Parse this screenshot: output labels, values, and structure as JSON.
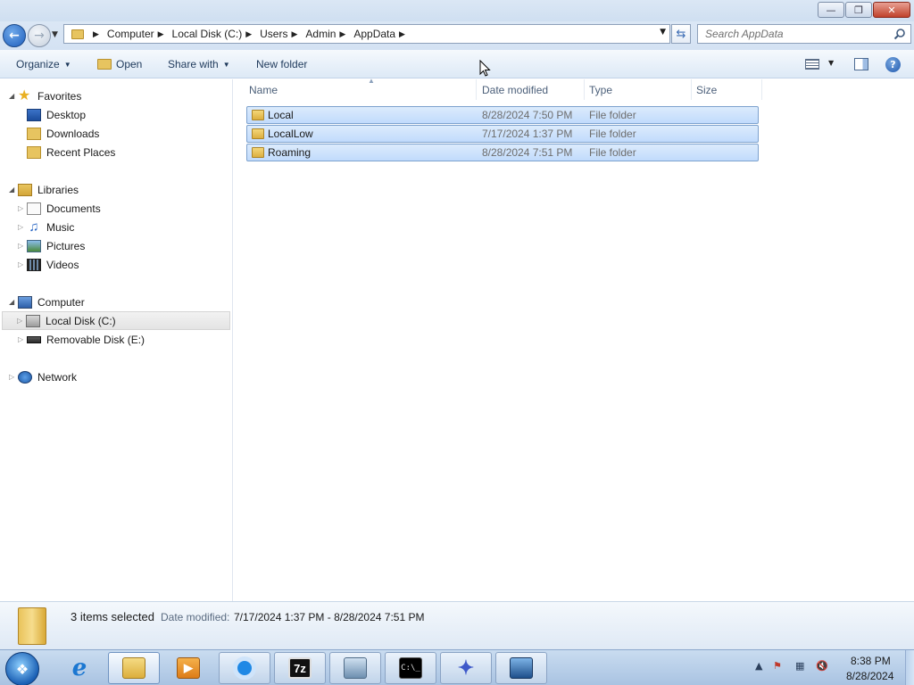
{
  "window": {
    "buttons": [
      "minimize",
      "maximize",
      "close"
    ]
  },
  "address": {
    "breadcrumb": [
      "Computer",
      "Local Disk (C:)",
      "Users",
      "Admin",
      "AppData"
    ],
    "search_placeholder": "Search AppData"
  },
  "toolbar": {
    "organize": "Organize",
    "open": "Open",
    "share_with": "Share with",
    "new_folder": "New folder"
  },
  "nav": {
    "favorites": "Favorites",
    "desktop": "Desktop",
    "downloads": "Downloads",
    "recent_places": "Recent Places",
    "libraries": "Libraries",
    "documents": "Documents",
    "music": "Music",
    "pictures": "Pictures",
    "videos": "Videos",
    "computer": "Computer",
    "local_disk": "Local Disk (C:)",
    "removable_disk": "Removable Disk (E:)",
    "network": "Network"
  },
  "columns": {
    "name": "Name",
    "date_modified": "Date modified",
    "type": "Type",
    "size": "Size"
  },
  "files": [
    {
      "name": "Local",
      "date": "8/28/2024 7:50 PM",
      "type": "File folder"
    },
    {
      "name": "LocalLow",
      "date": "7/17/2024 1:37 PM",
      "type": "File folder"
    },
    {
      "name": "Roaming",
      "date": "8/28/2024 7:51 PM",
      "type": "File folder"
    }
  ],
  "details": {
    "selection": "3 items selected",
    "date_label": "Date modified:",
    "date_range": "7/17/2024 1:37 PM - 8/28/2024 7:51 PM"
  },
  "taskbar": {
    "sevenzip_label": "7z",
    "time": "8:38 PM",
    "date": "8/28/2024"
  },
  "colors": {
    "selection_fill": "#cce0fb",
    "selection_border": "#7da2ce",
    "link_text": "#1e395b"
  }
}
